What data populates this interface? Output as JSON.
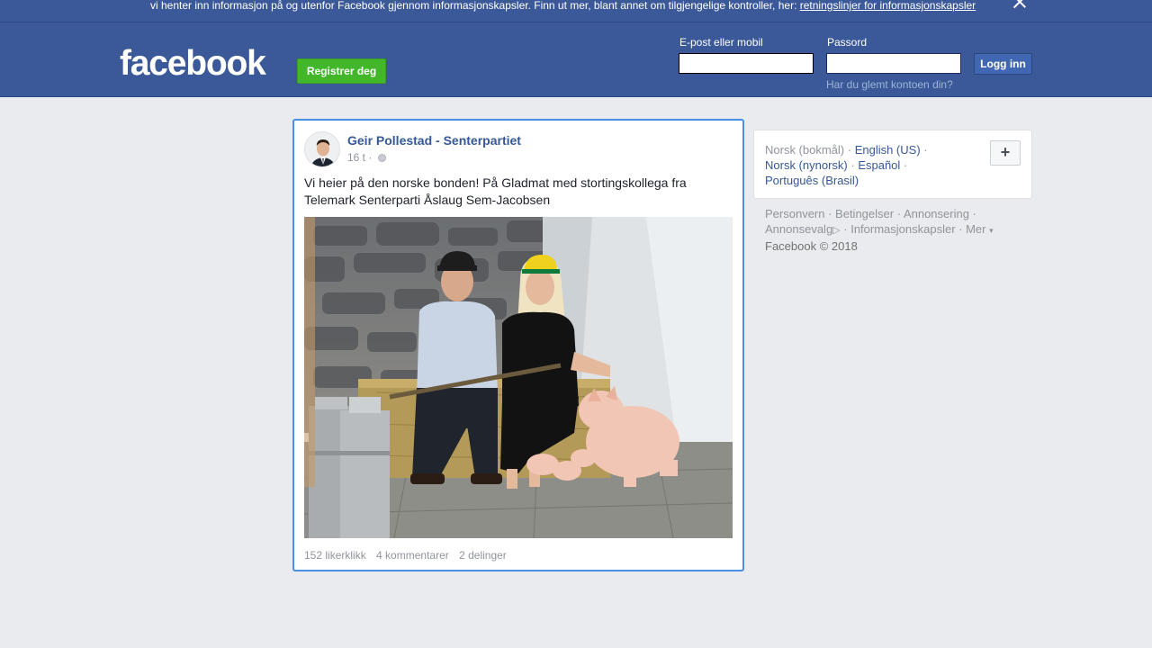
{
  "banner": {
    "text": "vi henter inn informasjon på og utenfor Facebook gjennom informasjonskapsler. Finn ut mer, blant annet om tilgjengelige kontroller, her:",
    "link": "retningslinjer for informasjonskapsler"
  },
  "header": {
    "logo": "facebook",
    "register": "Registrer deg",
    "email_label": "E-post eller mobil",
    "password_label": "Passord",
    "login": "Logg inn",
    "forgot": "Har du glemt kontoen din?",
    "email_value": "",
    "password_value": ""
  },
  "post": {
    "author": "Geir Pollestad - Senterpartiet",
    "time": "16 t ·",
    "text": "Vi heier på den norske bonden! På Gladmat med stortingskollega fra Telemark Senterparti Åslaug Sem-Jacobsen",
    "likes": "152 likerklikk",
    "comments": "4 kommentarer",
    "shares": "2 delinger"
  },
  "languages": {
    "current": "Norsk (bokmål)",
    "links": [
      "English (US)",
      "Norsk (nynorsk)",
      "Español",
      "Português (Brasil)"
    ]
  },
  "footer": {
    "links": [
      "Personvern",
      "Betingelser",
      "Annonsering",
      "Annonsevalg",
      "Informasjonskapsler",
      "Mer"
    ],
    "copyright": "Facebook © 2018"
  },
  "colors": {
    "brand": "#3b5998",
    "link": "#365899",
    "register": "#42b72a",
    "focus_border": "#4a90e2"
  }
}
